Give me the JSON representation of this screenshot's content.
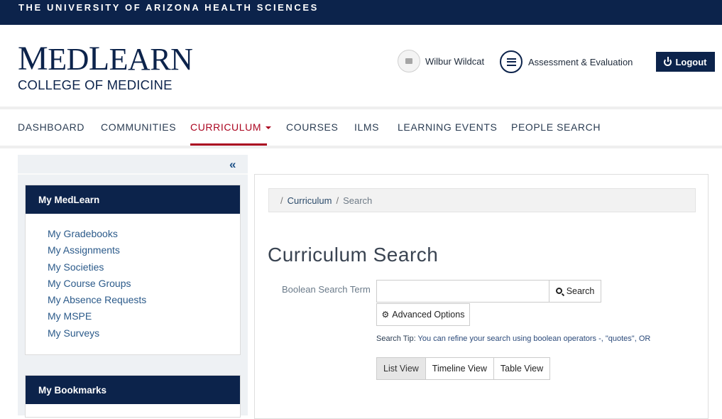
{
  "topbar": {
    "university": "THE UNIVERSITY OF ARIZONA HEALTH SCIENCES"
  },
  "logo": {
    "first": "M",
    "rest_one": "ED",
    "mid": "L",
    "rest_two": "EARN",
    "subtitle": "COLLEGE OF MEDICINE"
  },
  "user": {
    "name": "Wilbur Wildcat"
  },
  "assessment": {
    "label": "Assessment & Evaluation"
  },
  "logout": {
    "label": "Logout"
  },
  "nav": {
    "dashboard": "DASHBOARD",
    "communities": "COMMUNITIES",
    "curriculum": "CURRICULUM",
    "courses": "COURSES",
    "ilms": "ILMS",
    "learning_events": "LEARNING EVENTS",
    "people_search": "PEOPLE SEARCH"
  },
  "sidebar": {
    "collapse_icon": "«",
    "my_medlearn": {
      "title": "My MedLearn",
      "items": [
        "My Gradebooks",
        "My Assignments",
        "My Societies",
        "My Course Groups",
        "My Absence Requests",
        "My MSPE",
        "My Surveys"
      ]
    },
    "my_bookmarks": {
      "title": "My Bookmarks"
    }
  },
  "breadcrumb": {
    "sep": "/",
    "link": "Curriculum",
    "current": "Search"
  },
  "page": {
    "title": "Curriculum Search"
  },
  "search": {
    "label": "Boolean Search Term",
    "value": "",
    "button": "Search",
    "advanced": "Advanced Options",
    "tip_label": "Search Tip:",
    "tip_body": "You can refine your search using boolean operators -, \"quotes\", OR"
  },
  "views": {
    "list": "List View",
    "timeline": "Timeline View",
    "table": "Table View",
    "selected": "List View"
  },
  "colors": {
    "navy": "#0c234b",
    "red": "#ab0520",
    "link": "#2b5a8a"
  }
}
